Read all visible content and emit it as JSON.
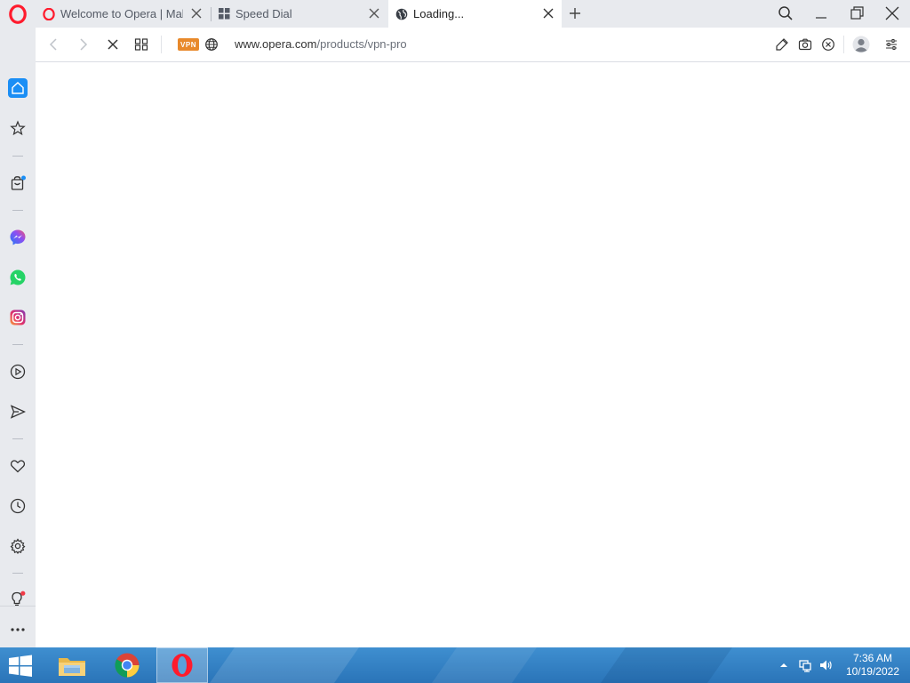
{
  "browser": {
    "name": "Opera",
    "accent_color": "#ff1b2d"
  },
  "tabs": [
    {
      "title": "Welcome to Opera | Make",
      "icon": "opera-logo-icon",
      "active": false
    },
    {
      "title": "Speed Dial",
      "icon": "speed-dial-icon",
      "active": false
    },
    {
      "title": "Loading...",
      "icon": "globe-icon",
      "active": true
    }
  ],
  "address_bar": {
    "vpn_label": "VPN",
    "url_host": "www.opera.com",
    "url_path": "/products/vpn-pro"
  },
  "sidebar": {
    "items": [
      {
        "name": "home",
        "icon": "home-icon",
        "active": true
      },
      {
        "name": "bookmarks",
        "icon": "star-icon"
      },
      {
        "name": "shopping",
        "icon": "shopping-bag-icon",
        "badge": true
      },
      {
        "name": "messenger",
        "icon": "messenger-icon",
        "color": "#4a6cf7"
      },
      {
        "name": "whatsapp",
        "icon": "whatsapp-icon",
        "color": "#25d366"
      },
      {
        "name": "instagram",
        "icon": "instagram-icon",
        "color": "#d62976"
      },
      {
        "name": "player",
        "icon": "play-circle-icon"
      },
      {
        "name": "flow",
        "icon": "send-icon"
      },
      {
        "name": "favorites",
        "icon": "heart-icon"
      },
      {
        "name": "history",
        "icon": "clock-icon"
      },
      {
        "name": "settings",
        "icon": "gear-icon"
      },
      {
        "name": "tips",
        "icon": "lightbulb-icon",
        "badge": true
      },
      {
        "name": "more",
        "icon": "ellipsis-icon"
      }
    ]
  },
  "taskbar": {
    "apps": [
      {
        "name": "file-explorer",
        "icon": "folder-icon"
      },
      {
        "name": "chrome",
        "icon": "chrome-icon"
      },
      {
        "name": "opera",
        "icon": "opera-logo-icon",
        "active": true
      }
    ],
    "clock": {
      "time": "7:36 AM",
      "date": "10/19/2022"
    }
  }
}
